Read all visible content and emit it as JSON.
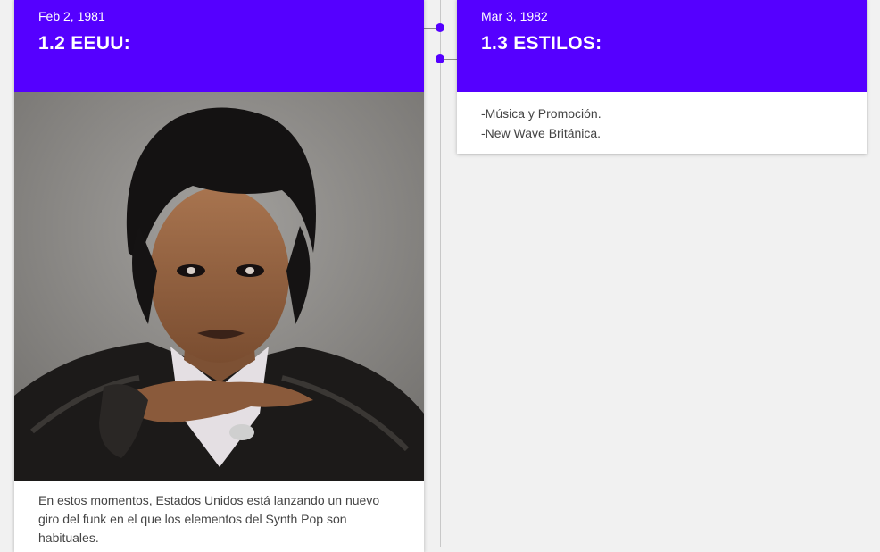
{
  "colors": {
    "accent": "#5500ff",
    "background": "#f1f1f1",
    "card": "#ffffff",
    "text": "#444444"
  },
  "timeline": {
    "events": [
      {
        "date": "Feb 2, 1981",
        "title": "1.2 EEUU:",
        "body": "En estos momentos, Estados Unidos está lanzando un nuevo giro del funk en el que los elementos del Synth Pop son habituales."
      },
      {
        "date": "Mar 3, 1982",
        "title": "1.3 ESTILOS:",
        "lines": [
          "-Música y Promoción.",
          "-New Wave Británica."
        ]
      }
    ]
  }
}
